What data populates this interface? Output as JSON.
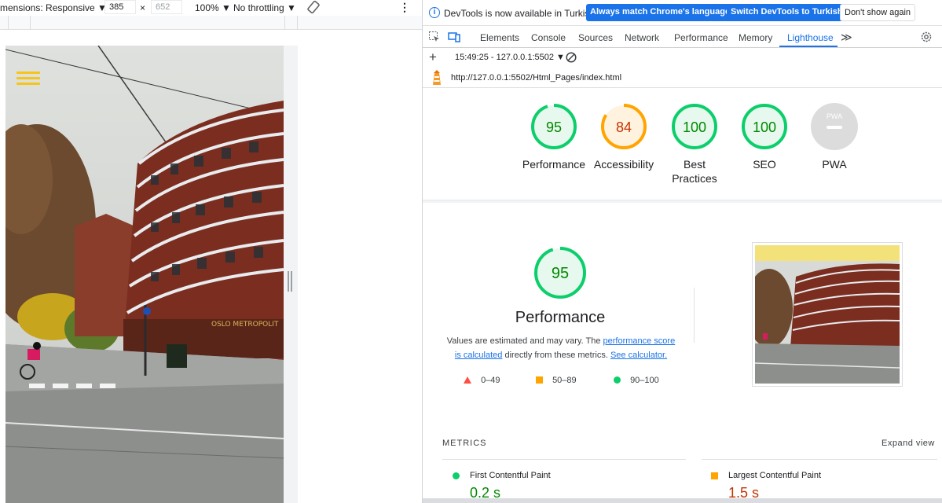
{
  "device_toolbar": {
    "dimensions_label": "mensions: Responsive ▼",
    "width": "385",
    "height": "652",
    "times": "×",
    "zoom": "100% ▼",
    "throttling": "No throttling ▼",
    "more": "⋮"
  },
  "viewport_sign": "OSLO METROPOLIT",
  "devtools": {
    "info_text": "DevTools is now available in Turkish!",
    "btn_match": "Always match Chrome's language",
    "btn_switch": "Switch DevTools to Turkish",
    "btn_dont": "Don't show again",
    "tabs": [
      "Elements",
      "Console",
      "Sources",
      "Network",
      "Performance",
      "Memory",
      "Lighthouse"
    ],
    "more_tabs": "≫",
    "report_selector": "15:49:25 - 127.0.0.1:5502 ▼",
    "url": "http://127.0.0.1:5502/Html_Pages/index.html"
  },
  "scores": [
    {
      "label": "Performance",
      "value": "95",
      "score": 95,
      "color": "#0cce6b"
    },
    {
      "label": "Accessibility",
      "value": "84",
      "score": 84,
      "color": "#ffa400"
    },
    {
      "label": "Best Practices",
      "value": "100",
      "score": 100,
      "color": "#0cce6b"
    },
    {
      "label": "SEO",
      "value": "100",
      "score": 100,
      "color": "#0cce6b"
    },
    {
      "label": "PWA",
      "value": "PWA",
      "score": 0,
      "color": "#bdbdbd"
    }
  ],
  "performance": {
    "score": "95",
    "title": "Performance",
    "desc_1": "Values are estimated and may vary. The ",
    "link_1": "performance score",
    "link_2": "is calculated",
    "desc_2": " directly from these metrics. ",
    "link_3": "See calculator.",
    "legend": [
      {
        "range": "0–49",
        "color": "#ff4e42"
      },
      {
        "range": "50–89",
        "color": "#ffa400"
      },
      {
        "range": "90–100",
        "color": "#0cce6b"
      }
    ]
  },
  "metrics": {
    "heading": "METRICS",
    "expand": "Expand view",
    "fcp_label": "First Contentful Paint",
    "fcp_value": "0.2 s",
    "lcp_label": "Largest Contentful Paint",
    "lcp_value": "1.5 s"
  },
  "colors": {
    "pass": "#0cce6b",
    "average": "#ffa400",
    "fail": "#ff4e42",
    "pass_text": "#008800",
    "average_text": "#c33300",
    "accent": "#1a73e8"
  }
}
